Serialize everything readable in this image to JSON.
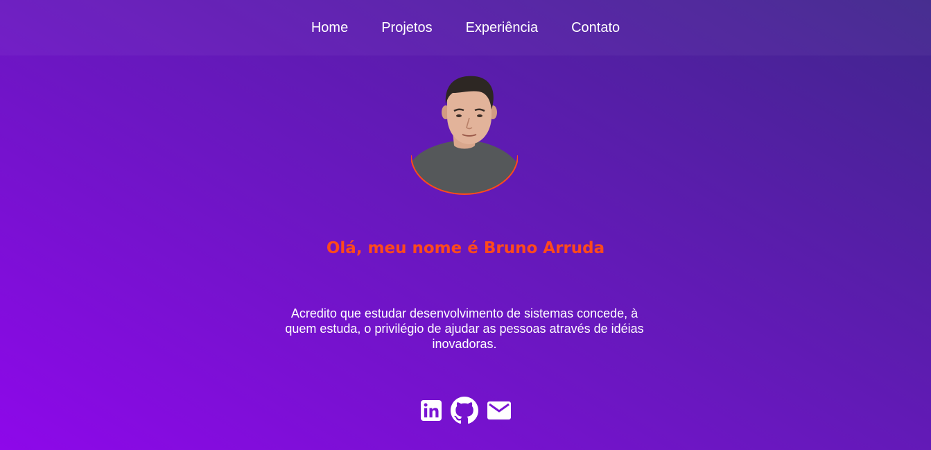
{
  "nav": {
    "items": [
      {
        "label": "Home"
      },
      {
        "label": "Projetos"
      },
      {
        "label": "Experiência"
      },
      {
        "label": "Contato"
      }
    ]
  },
  "hero": {
    "headline": "Olá, meu nome é Bruno Arruda",
    "bio": "Acredito que estudar desenvolvimento de sistemas concede, à quem estuda, o privilégio de ajudar as pessoas através de idéias inovadoras."
  },
  "social": {
    "icons": [
      "linkedin-icon",
      "github-icon",
      "email-icon"
    ]
  },
  "colors": {
    "accent": "#ff4a1c",
    "background_start": "#8e08ea",
    "background_end": "#40268c",
    "text": "#ffffff"
  }
}
